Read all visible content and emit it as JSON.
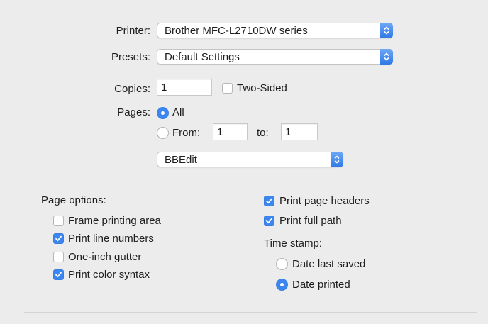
{
  "printer": {
    "label": "Printer:",
    "value": "Brother MFC-L2710DW series"
  },
  "presets": {
    "label": "Presets:",
    "value": "Default Settings"
  },
  "copies": {
    "label": "Copies:",
    "value": "1",
    "two_sided_label": "Two-Sided",
    "two_sided_checked": false
  },
  "pages": {
    "label": "Pages:",
    "all_label": "All",
    "all_selected": true,
    "from_label": "From:",
    "from_value": "1",
    "to_label": "to:",
    "to_value": "1"
  },
  "app_menu": {
    "value": "BBEdit"
  },
  "page_options": {
    "label": "Page options:",
    "items": [
      {
        "label": "Frame printing area",
        "checked": false
      },
      {
        "label": "Print line numbers",
        "checked": true
      },
      {
        "label": "One-inch gutter",
        "checked": false
      },
      {
        "label": "Print color syntax",
        "checked": true
      }
    ]
  },
  "right_options": {
    "items": [
      {
        "label": "Print page headers",
        "checked": true
      },
      {
        "label": "Print full path",
        "checked": true
      }
    ],
    "time_stamp_label": "Time stamp:",
    "time_stamp_options": [
      {
        "label": "Date last saved",
        "selected": false
      },
      {
        "label": "Date printed",
        "selected": true
      }
    ]
  },
  "colors": {
    "accent": "#3b86f0",
    "background": "#ececec"
  }
}
